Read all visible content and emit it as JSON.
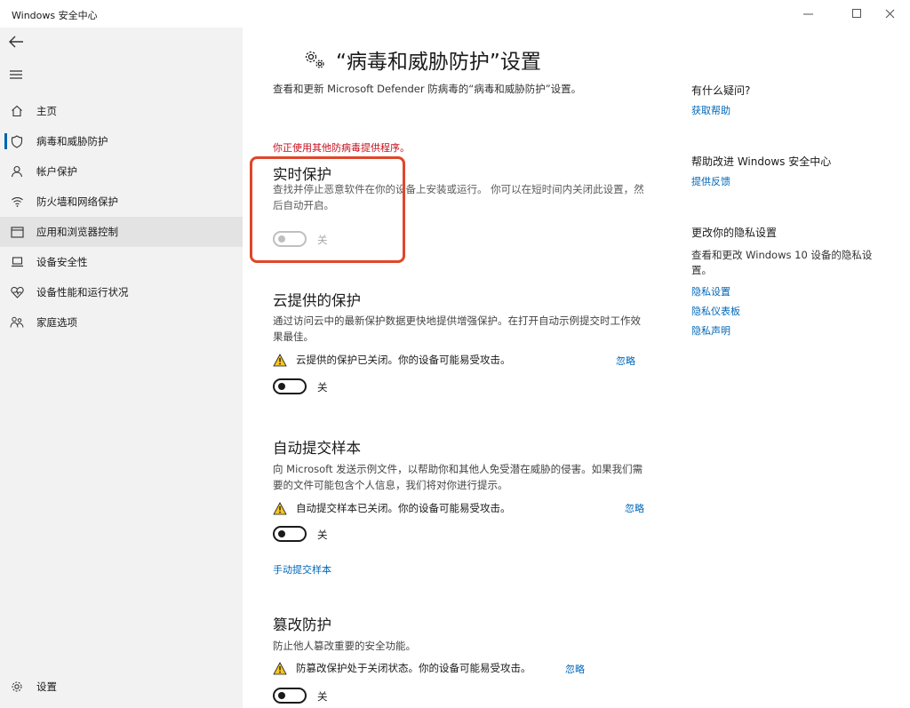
{
  "window": {
    "title": "Windows 安全中心"
  },
  "sidebar": {
    "items": [
      {
        "label": "主页",
        "icon": "home-icon"
      },
      {
        "label": "病毒和威胁防护",
        "icon": "shield-icon"
      },
      {
        "label": "帐户保护",
        "icon": "person-icon"
      },
      {
        "label": "防火墙和网络保护",
        "icon": "wifi-icon"
      },
      {
        "label": "应用和浏览器控制",
        "icon": "app-window-icon"
      },
      {
        "label": "设备安全性",
        "icon": "laptop-icon"
      },
      {
        "label": "设备性能和运行状况",
        "icon": "heart-icon"
      },
      {
        "label": "家庭选项",
        "icon": "family-icon"
      }
    ],
    "settings_label": "设置"
  },
  "main": {
    "title": "“病毒和威胁防护”设置",
    "subtitle": "查看和更新 Microsoft Defender 防病毒的“病毒和威胁防护”设置。",
    "red_notice": "你正使用其他防病毒提供程序。",
    "realtime": {
      "title": "实时保护",
      "desc": "查找并停止恶意软件在你的设备上安装或运行。 你可以在短时间内关闭此设置，然后自动开启。",
      "toggle_label": "关"
    },
    "cloud": {
      "title": "云提供的保护",
      "desc": "通过访问云中的最新保护数据更快地提供增强保护。在打开自动示例提交时工作效果最佳。",
      "alert": "云提供的保护已关闭。你的设备可能易受攻击。",
      "dismiss": "忽略",
      "toggle_label": "关"
    },
    "sample": {
      "title": "自动提交样本",
      "desc": "向 Microsoft 发送示例文件，以帮助你和其他人免受潜在威胁的侵害。如果我们需要的文件可能包含个人信息，我们将对你进行提示。",
      "alert": "自动提交样本已关闭。你的设备可能易受攻击。",
      "dismiss": "忽略",
      "toggle_label": "关",
      "manual_link": "手动提交样本"
    },
    "tamper": {
      "title": "篡改防护",
      "desc": "防止他人篡改重要的安全功能。",
      "alert": "防篡改保护处于关闭状态。你的设备可能易受攻击。",
      "dismiss": "忽略",
      "toggle_label": "关"
    }
  },
  "right": {
    "q_heading": "有什么疑问?",
    "q_link": "获取帮助",
    "improve_heading": "帮助改进 Windows 安全中心",
    "improve_link": "提供反馈",
    "privacy_heading": "更改你的隐私设置",
    "privacy_text": "查看和更改 Windows 10 设备的隐私设置。",
    "privacy_links": [
      "隐私设置",
      "隐私仪表板",
      "隐私声明"
    ]
  },
  "colors": {
    "accent": "#0067b8",
    "highlight": "#e0462a",
    "warning": "#c50f1f"
  }
}
